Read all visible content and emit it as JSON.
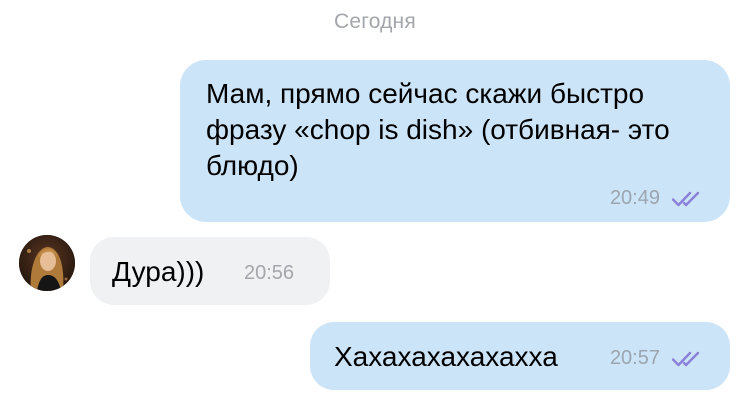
{
  "date_divider": "Сегодня",
  "messages": [
    {
      "direction": "outgoing",
      "text": "Мам, прямо сейчас скажи быстро фразу «chop is dish» (отбивная- это блюдо)",
      "time": "20:49",
      "status": "read"
    },
    {
      "direction": "incoming",
      "text": "Дура)))",
      "time": "20:56",
      "avatar": "contact-avatar"
    },
    {
      "direction": "outgoing",
      "text": "Хахахахахахахха",
      "time": "20:57",
      "status": "read"
    }
  ],
  "colors": {
    "outgoing_bubble": "#cce4f7",
    "incoming_bubble": "#f0f1f3",
    "read_checks": "#8b7fd8",
    "timestamp": "#9aa5b0"
  }
}
